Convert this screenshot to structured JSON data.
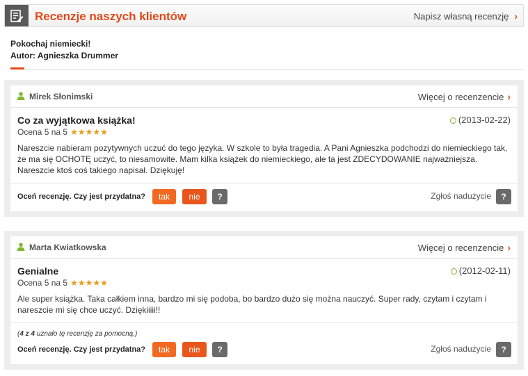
{
  "header": {
    "title": "Recenzje naszych klientów",
    "write_review": "Napisz własną recenzję",
    "icon": "edit-notes-icon"
  },
  "book": {
    "title": "Pokochaj niemiecki!",
    "author": "Autor: Agnieszka Drummer"
  },
  "colors": {
    "accent": "#e04a1a",
    "star": "#e89a1c",
    "clock": "#7cba2c"
  },
  "reviews": [
    {
      "user": "Mirek  Słonimski",
      "more_link": "Więcej o recenzencie",
      "title": "Co za wyjątkowa książka!",
      "rating_label": "Ocena 5 na 5",
      "stars": "★★★★★",
      "date": "(2013-02-22)",
      "text": "Nareszcie nabieram pozytywnych uczuć do tego języka. W szkole to była tragedia. A Pani Agnieszka podchodzi do niemieckiego tak, że ma się OCHOTĘ uczyć, to niesamowite. Mam kilka książek do niemieckiego, ale ta jest ZDECYDOWANIE najważniejsza. Nareszcie ktoś coś takiego napisał. Dziękuję!",
      "rate_label": "Oceń recenzję. Czy jest przydatna?",
      "yes": "tak",
      "no": "nie",
      "q": "?",
      "report": "Zgłoś nadużycie"
    },
    {
      "user": "Marta  Kwiatkowska",
      "more_link": "Więcej o recenzencie",
      "title": "Genialne",
      "rating_label": "Ocena 5 na 5",
      "stars": "★★★★★",
      "date": "(2012-02-11)",
      "text": "Ale super książka. Taka całkiem inna, bardzo mi się podoba, bo bardzo dużo się można nauczyć. Super rady, czytam i czytam i nareszcie mi się chce uczyć. Dziękiiiii!!",
      "helpful_count": "4 z 4",
      "helpful_rest": " uznało tę recenzję za pomocną.)",
      "helpful_open": "(",
      "rate_label": "Oceń recenzję. Czy jest przydatna?",
      "yes": "tak",
      "no": "nie",
      "q": "?",
      "report": "Zgłoś nadużycie"
    }
  ]
}
